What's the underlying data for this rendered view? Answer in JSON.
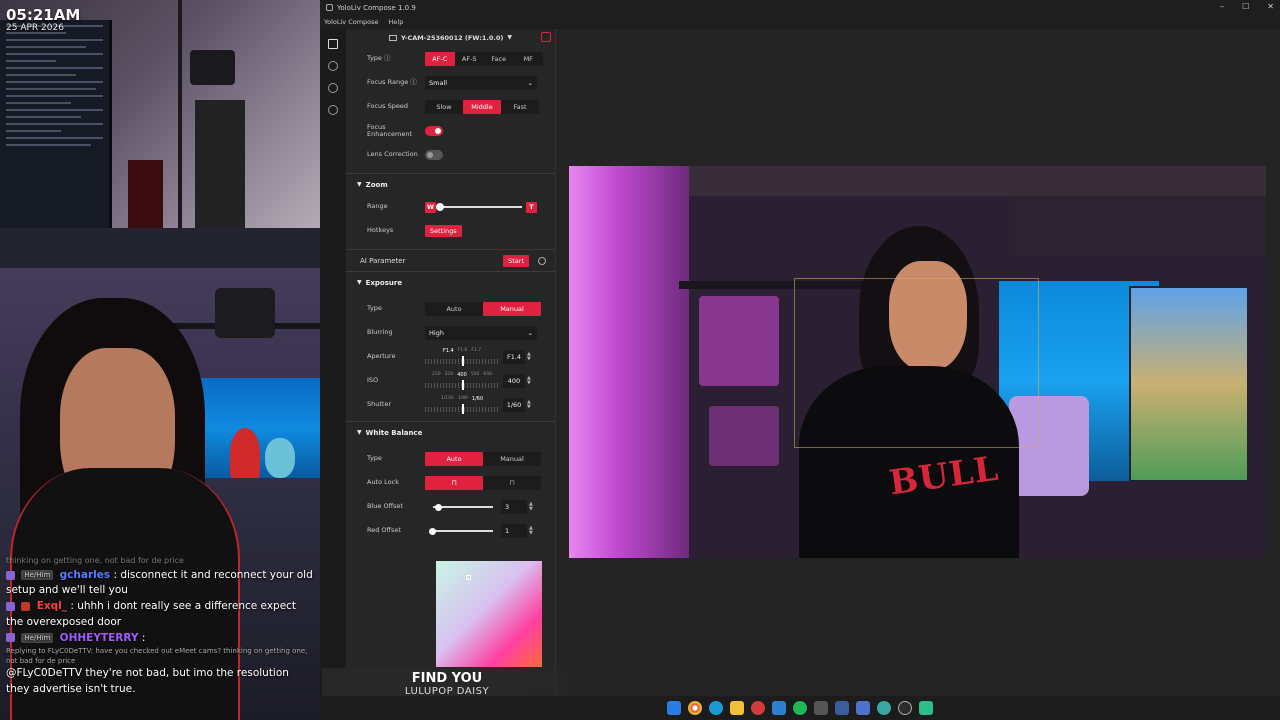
{
  "overlay": {
    "clock": "05:21AM",
    "date": "25 APR 2026"
  },
  "chat": {
    "partial_line": "thinking on getting one, not bad for de price",
    "messages": [
      {
        "pronoun": "He/Him",
        "user": "gcharles",
        "text": ": disconnect it and reconnect your old setup and we'll tell you"
      },
      {
        "pronoun": "",
        "user": "Exql_",
        "text": ": uhhh i dont really see a difference expect the overexposed door"
      },
      {
        "pronoun": "He/Him",
        "user": "OHHEYTERRY",
        "text": ":"
      }
    ],
    "reply_note": "Replying to FLyC0DeTTV: have you checked out eMeet cams? thinking on getting one, not bad for de price",
    "reply_text": "@FLyC0DeTTV they're not bad, but imo the resolution they advertise isn't true."
  },
  "window": {
    "title": "YoloLiv Compose  1.0.9",
    "menu": [
      "YoloLiv Compose",
      "Help"
    ],
    "controls": [
      "–",
      "☐",
      "✕"
    ]
  },
  "device": {
    "name": "Y-CAM-25360012 (FW:1.0.0)"
  },
  "focus": {
    "type_label": "Type ⓘ",
    "type_options": [
      "AF-C",
      "AF-S",
      "Face",
      "MF"
    ],
    "type_selected": "AF-C",
    "range_label": "Focus Range ⓘ",
    "range_value": "Small",
    "speed_label": "Focus Speed",
    "speed_options": [
      "Slow",
      "Middle",
      "Fast"
    ],
    "speed_selected": "Middle",
    "enhancement_label": "Focus Enhancement",
    "enhancement_on": true,
    "lens_label": "Lens Correction",
    "lens_on": false
  },
  "zoom": {
    "header": "Zoom",
    "range_label": "Range",
    "wide": "W",
    "tele": "T",
    "level": 0,
    "hotkeys_label": "Hotkeys",
    "settings_btn": "Settings"
  },
  "ai": {
    "label": "AI Parameter",
    "start_btn": "Start"
  },
  "exposure": {
    "header": "Exposure",
    "type_label": "Type",
    "type_options": [
      "Auto",
      "Manual"
    ],
    "type_selected": "Manual",
    "blurring_label": "Blurring",
    "blurring_value": "High",
    "aperture_label": "Aperture",
    "aperture_ticks": [
      "F1.4",
      "F1.6",
      "F1.7"
    ],
    "aperture_value": "F1.4",
    "iso_label": "ISO",
    "iso_ticks": [
      "250",
      "320",
      "400",
      "500",
      "640"
    ],
    "iso_value": "400",
    "shutter_label": "Shutter",
    "shutter_ticks": [
      "1/100",
      "1/80",
      "1/60"
    ],
    "shutter_value": "1/60"
  },
  "white_balance": {
    "header": "White Balance",
    "type_label": "Type",
    "type_options": [
      "Auto",
      "Manual"
    ],
    "type_selected": "Auto",
    "auto_lock_label": "Auto Lock",
    "blue_label": "Blue Offset",
    "blue_value": "3",
    "blue_level": 0.1,
    "red_label": "Red Offset",
    "red_value": "1",
    "red_level": 0.0
  },
  "preview": {
    "jersey_text": "BULL"
  },
  "music": {
    "title": "FIND YOU",
    "artist": "LULUPOP DAISY"
  },
  "colors": {
    "accent": "#e0213f",
    "panel_bg": "#262626",
    "app_bg": "#242424"
  },
  "taskbar": {
    "icons": [
      "windows-icon",
      "chrome-icon",
      "edge-icon",
      "folder-icon",
      "app-icon",
      "vscode-icon",
      "spotify-icon",
      "terminal-icon",
      "app-icon",
      "app-icon",
      "browser-icon",
      "obs-icon",
      "app-icon"
    ]
  }
}
